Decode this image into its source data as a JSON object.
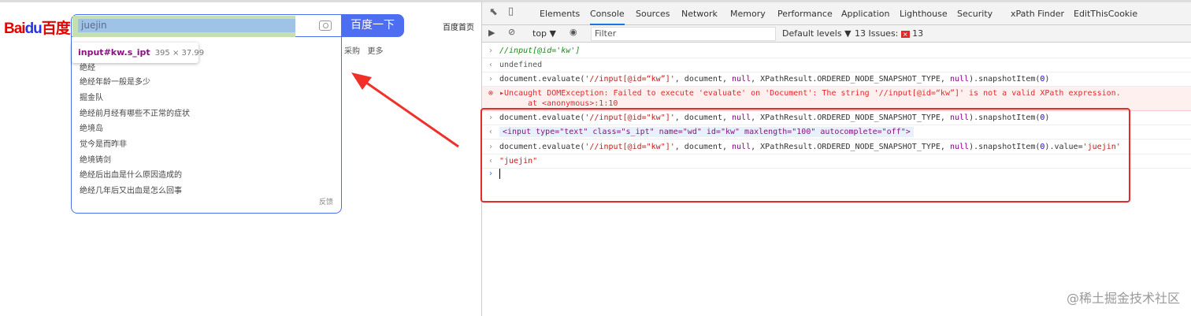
{
  "baidu": {
    "logo_text": "Bai",
    "logo_du": "du",
    "logo_cn": "百度",
    "search_value": "juejin",
    "search_button": "百度一下",
    "home_link": "百度首页",
    "purchase_link": "采购",
    "more_link": "更多",
    "suggestions": [
      "绝经",
      "绝经年龄一般是多少",
      "掘金队",
      "绝经前月经有哪些不正常的症状",
      "绝境岛",
      "觉今是而昨非",
      "绝境铸剑",
      "绝经后出血是什么原因造成的",
      "绝经几年后又出血是怎么回事"
    ],
    "feedback": "反馈",
    "tooltip": {
      "selector": "input#kw.s_ipt",
      "size": "395 × 37.99"
    }
  },
  "devtools": {
    "tabs": [
      "Elements",
      "Console",
      "Sources",
      "Network",
      "Memory",
      "Performance",
      "Application",
      "Lighthouse",
      "Security",
      "xPath Finder",
      "EditThisCookie"
    ],
    "active_tab": "Console",
    "context": "top ▼",
    "filter_placeholder": "Filter",
    "levels": "Default levels ▼",
    "issues_label": "13 Issues:",
    "issues_count": "13",
    "console": {
      "l1": "//input[@id='kw']",
      "l2": "undefined",
      "eval_prefix": "document.evaluate(",
      "xpath_bad": "'//input[@id=“kw”]'",
      "xpath_good": "'//input[@id=\"kw\"]'",
      "eval_mid": ", document, ",
      "null": "null",
      "eval_mid2": ", XPathResult.ORDERED_NODE_SNAPSHOT_TYPE, ",
      "eval_end": ").snapshotItem(",
      "zero": "0",
      "close": ")",
      "assign": ".value=",
      "juejin_str": "'juejin'",
      "error": "Uncaught DOMException: Failed to execute 'evaluate' on 'Document': The string '//input[@id=“kw”]' is not a valid XPath expression.",
      "error_loc": "at <anonymous>:1:10",
      "element": "<input type=\"text\" class=\"s_ipt\" name=\"wd\" id=\"kw\" maxlength=\"100\" autocomplete=\"off\">",
      "result": "\"juejin\""
    }
  },
  "watermark": "@稀土掘金技术社区"
}
